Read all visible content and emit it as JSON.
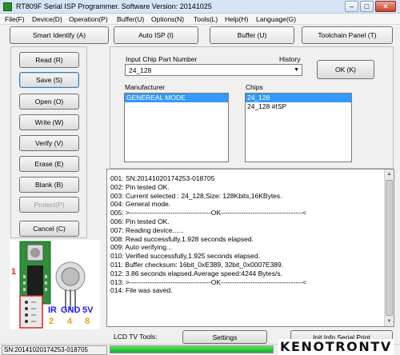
{
  "window": {
    "title": "RT809F Serial ISP Programmer. Software Version: 20141025",
    "min": "–",
    "max": "□",
    "close": "✕"
  },
  "menu": [
    "File(F)",
    "Device(D)",
    "Operation(P)",
    "Buffer(U)",
    "Options(N)",
    "Tools(L)",
    "Help(H)",
    "Language(G)"
  ],
  "toolbar": {
    "smart_identify": "Smart Identify (A)",
    "auto_isp": "Auto ISP (I)",
    "buffer": "Buffer (U)",
    "toolchain": "Toolchain Panel (T)"
  },
  "actions": [
    "Read (R)",
    "Save (S)",
    "Open (O)",
    "Write (W)",
    "Verify (V)",
    "Erase (E)",
    "Blank (B)",
    "Protect(P)"
  ],
  "cancel": "Cancel (C)",
  "chip": {
    "label": "Input Chip Part Number",
    "history_label": "History",
    "value": "24_128",
    "ok": "OK (K)"
  },
  "manufacturer": {
    "label": "Manufacturer",
    "items": [
      "GENEREAL MODE"
    ]
  },
  "chips": {
    "label": "Chips",
    "items": [
      "24_128",
      "24_128 #ISP"
    ]
  },
  "log": [
    "001: SN:20141020174253-018705",
    "002: Pin tested OK.",
    "003: Current selected : 24_128,Size: 128Kbits,16KBytes.",
    "004: General mode.",
    "005: >------------------------------------OK------------------------------------<",
    "006: Pin tested OK.",
    "007: Reading device......",
    "008: Read successfully,1.928 seconds elapsed.",
    "009: Auto verifying...",
    "010: Verified successfully,1.925 seconds elapsed.",
    "011: Buffer checksum: 16bit_0xE389, 32bit_0x0007E389.",
    "012: 3.86 seconds elapsed.Average speed:4244 Bytes/s.",
    "013: >------------------------------------OK------------------------------------<",
    "014: File was saved."
  ],
  "bottom": {
    "lcd_label": "LCD TV Tools:",
    "settings": "Settings",
    "init_info": "Init Info Serial Print"
  },
  "status": {
    "sn": "SN:20141020174253-018705",
    "progress": 1.0
  },
  "pcb": {
    "pin_number": "1",
    "labels": [
      "IR",
      "GND",
      "5V"
    ],
    "numbers": [
      "2",
      "4",
      "8"
    ]
  },
  "watermark": "KENOTRONTV",
  "colors": {
    "selection": "#3399ff",
    "progress": "#06b025",
    "pin_number": "#e02020",
    "pin_label": "#1a1aff",
    "pin_number_alt": "#f0a000"
  }
}
